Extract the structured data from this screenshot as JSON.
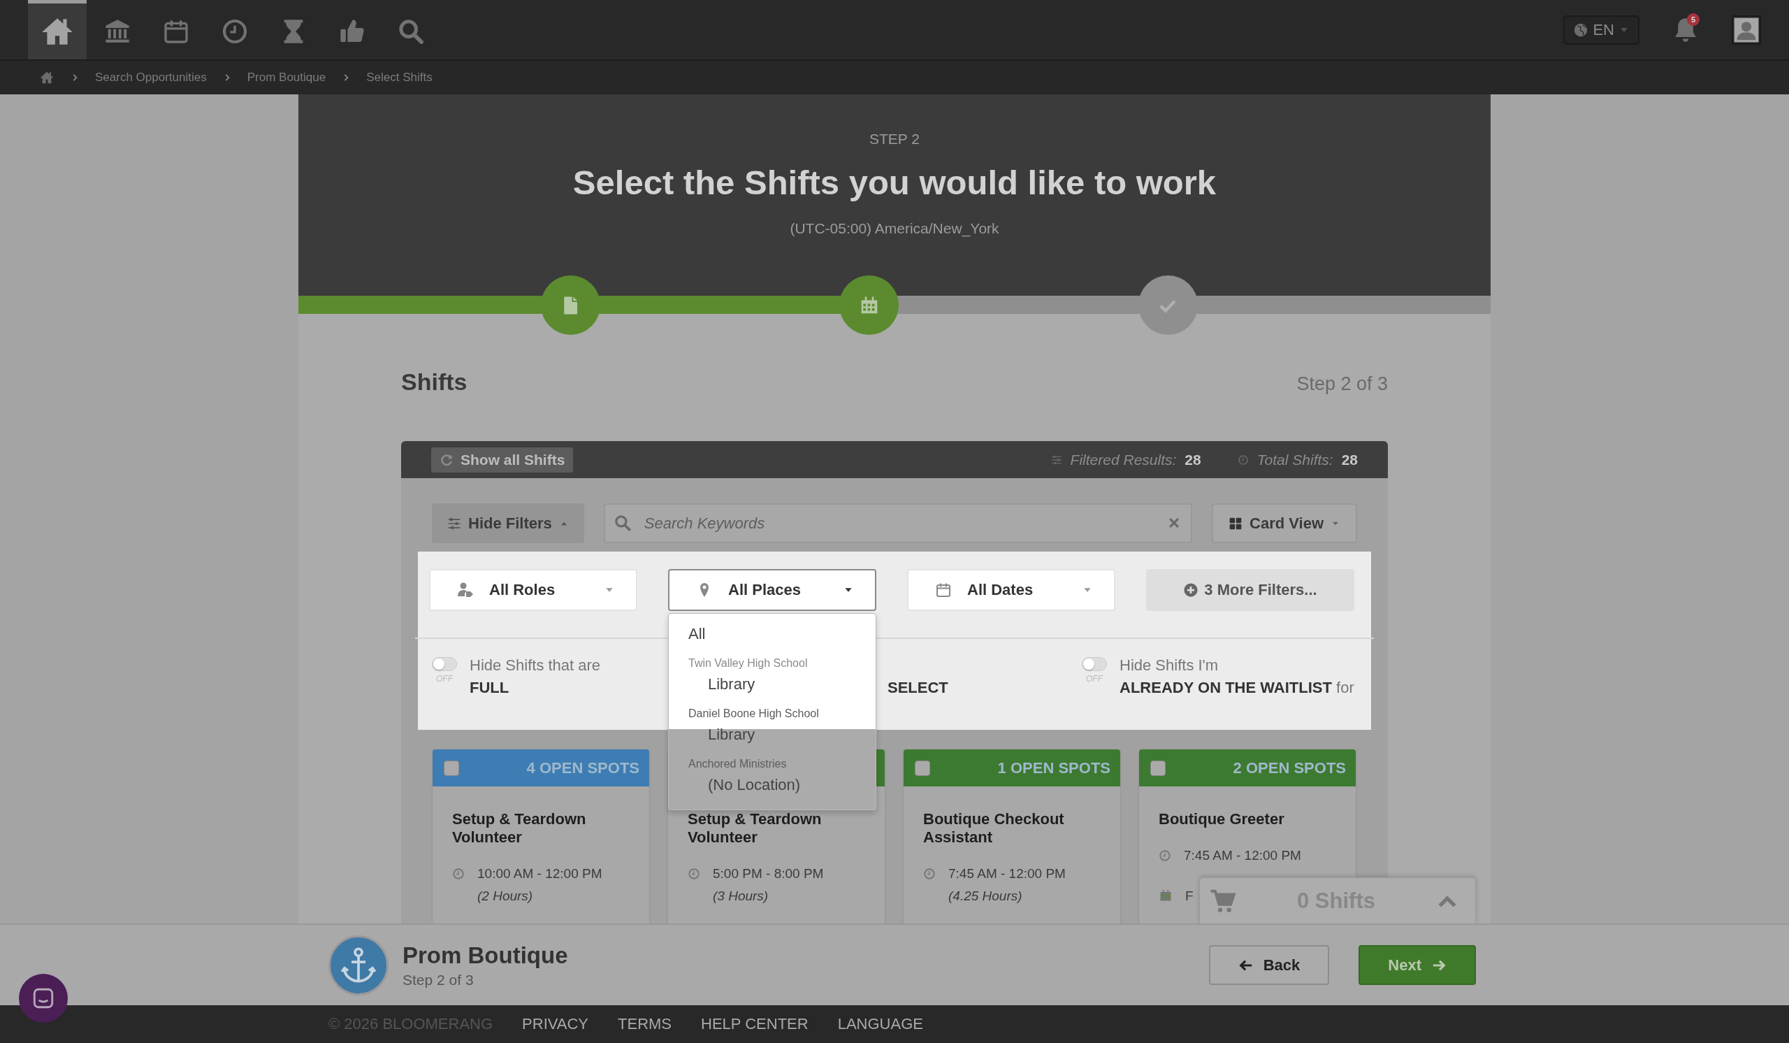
{
  "nav": {
    "items": [
      {
        "kind": "home",
        "selected": true
      },
      {
        "kind": "bank",
        "selected": false
      },
      {
        "kind": "calendar",
        "selected": false
      },
      {
        "kind": "clock",
        "selected": false
      },
      {
        "kind": "hourglass",
        "selected": false
      },
      {
        "kind": "thumbs",
        "selected": false
      },
      {
        "kind": "search",
        "selected": false
      }
    ]
  },
  "language": "EN",
  "notifications": "5",
  "breadcrumb": [
    "Search Opportunities",
    "Prom Boutique",
    "Select Shifts"
  ],
  "header": {
    "step_label": "STEP 2",
    "title": "Select the Shifts you would like to work",
    "timezone": "(UTC-05:00) America/New_York"
  },
  "progress": {
    "level": 0.479,
    "steps": [
      {
        "kind": "file",
        "done": true
      },
      {
        "kind": "calendar",
        "done": true
      },
      {
        "kind": "check",
        "done": false
      }
    ]
  },
  "shifts": {
    "heading": "Shifts",
    "step": "Step 2 of 3",
    "show_all": "Show all Shifts",
    "filtered_label": "Filtered Results:",
    "filtered": "28",
    "total_label": "Total Shifts:",
    "total": "28",
    "hide_filters": "Hide Filters",
    "search": {
      "placeholder": "Search Keywords"
    },
    "view": "Card View",
    "filters": [
      {
        "kind": "roles",
        "label": "All Roles",
        "open": false
      },
      {
        "kind": "places",
        "label": "All Places",
        "open": true
      },
      {
        "kind": "dates",
        "label": "All Dates",
        "open": false
      }
    ],
    "more_filters": "3 More Filters...",
    "places_menu": [
      {
        "kind": "option",
        "label": "All"
      },
      {
        "kind": "group",
        "label": "Twin Valley High School"
      },
      {
        "kind": "suboption",
        "label": "Library"
      },
      {
        "kind": "group",
        "label": "Daniel Boone High School"
      },
      {
        "kind": "suboption",
        "label": "Library"
      },
      {
        "kind": "group",
        "label": "Anchored Ministries"
      },
      {
        "kind": "suboption",
        "label": "(No Location)"
      }
    ],
    "toggles": [
      {
        "lead": "Hide Shifts that are",
        "emphasis": "FULL",
        "on": false,
        "state_label": "OFF"
      },
      {
        "lead": "Hide Shifts I'm",
        "emphasis": "ALREADY ON THE WAITLIST",
        "trail": "for",
        "on": false,
        "state_label": "OFF"
      }
    ],
    "covered_toggle_text": "SELECT"
  },
  "cards": [
    {
      "color": "#3d7db3",
      "spots": "4 OPEN SPOTS",
      "checked": false,
      "title": "Setup & Teardown Volunteer",
      "time": "10:00 AM - 12:00 PM",
      "duration": "(2 Hours)"
    },
    {
      "color": "#3d7a31",
      "title": "Setup & Teardown Volunteer",
      "time": "5:00 PM - 8:00 PM",
      "duration": "(3 Hours)"
    },
    {
      "color": "#3d7a31",
      "spots": "1 OPEN SPOTS",
      "checked": false,
      "title": "Boutique Checkout Assistant",
      "time": "7:45 AM - 12:00 PM",
      "duration": "(4.25 Hours)"
    },
    {
      "color": "#3d7a31",
      "spots": "2 OPEN SPOTS",
      "checked": false,
      "title": "Boutique Greeter",
      "time": "7:45 AM - 12:00 PM",
      "date": "F"
    }
  ],
  "cart": {
    "count": "0 Shifts"
  },
  "bottom": {
    "title": "Prom Boutique",
    "subtitle": "Step 2 of 3",
    "back": "Back",
    "next": "Next"
  },
  "footer": [
    {
      "kind": "copyright",
      "label": "© 2026 BLOOMERANG"
    },
    {
      "kind": "link",
      "label": "PRIVACY"
    },
    {
      "kind": "link",
      "label": "TERMS"
    },
    {
      "kind": "link",
      "label": "HELP CENTER"
    },
    {
      "kind": "link",
      "label": "LANGUAGE"
    }
  ]
}
